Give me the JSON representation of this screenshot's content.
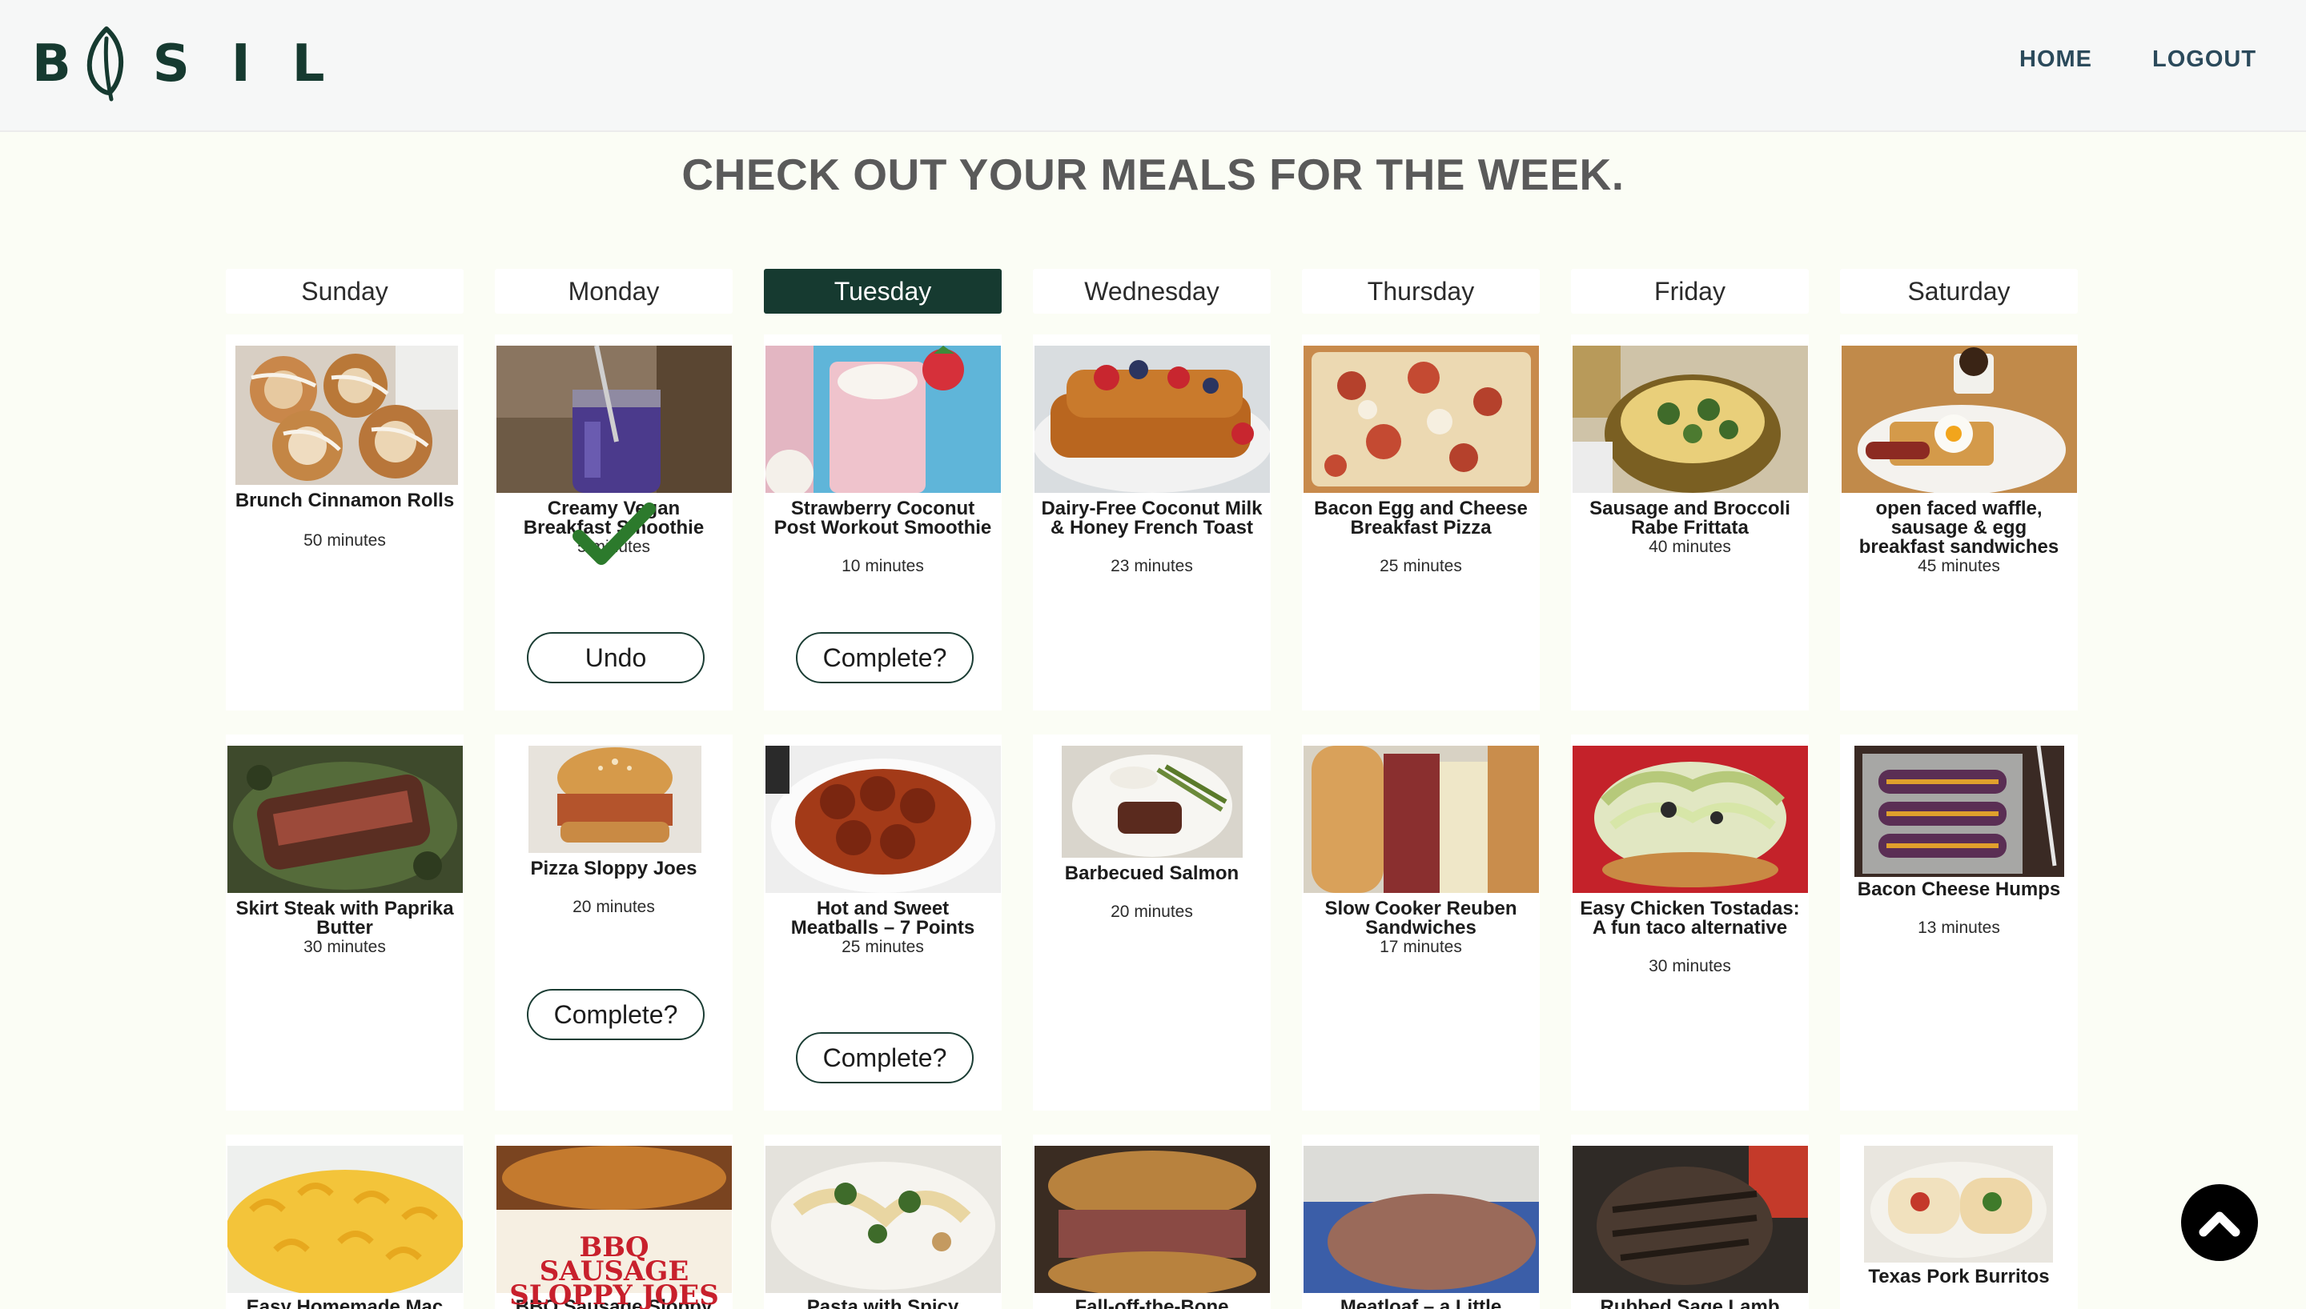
{
  "brand": {
    "letters": [
      "B",
      "S",
      "I",
      "L"
    ],
    "color": "#163a30",
    "logo_icon": "leaf-icon"
  },
  "nav": {
    "home": "HOME",
    "logout": "LOGOUT"
  },
  "page_title": "CHECK OUT YOUR MEALS FOR THE WEEK.",
  "days": [
    "Sunday",
    "Monday",
    "Tuesday",
    "Wednesday",
    "Thursday",
    "Friday",
    "Saturday"
  ],
  "active_day": "Tuesday",
  "accent_color": "#163a30",
  "weeks": [
    {
      "meals": [
        {
          "name": "Brunch Cinnamon Rolls",
          "time": "50 minutes"
        },
        {
          "name": "Creamy Vegan Breakfast Smoothie",
          "time": "5 minutes",
          "completed": true,
          "button": "Undo"
        },
        {
          "name": "Strawberry Coconut Post Workout Smoothie",
          "time": "10 minutes",
          "button": "Complete?"
        },
        {
          "name": "Dairy-Free Coconut Milk & Honey French Toast",
          "time": "23 minutes"
        },
        {
          "name": "Bacon Egg and Cheese Breakfast Pizza",
          "time": "25 minutes"
        },
        {
          "name": "Sausage and Broccoli Rabe Frittata",
          "time": "40 minutes"
        },
        {
          "name": "open faced waffle, sausage & egg breakfast sandwiches",
          "time": "45 minutes"
        }
      ]
    },
    {
      "meals": [
        {
          "name": "Skirt Steak with Paprika Butter",
          "time": "30 minutes"
        },
        {
          "name": "Pizza Sloppy Joes",
          "time": "20 minutes",
          "button": "Complete?"
        },
        {
          "name": "Hot and Sweet Meatballs – 7 Points",
          "time": "25 minutes",
          "button": "Complete?"
        },
        {
          "name": "Barbecued Salmon",
          "time": "20 minutes"
        },
        {
          "name": "Slow Cooker Reuben Sandwiches",
          "time": "17 minutes"
        },
        {
          "name": "Easy Chicken Tostadas: A fun taco alternative",
          "time": "30 minutes"
        },
        {
          "name": "Bacon Cheese Humps",
          "time": "13 minutes"
        }
      ]
    },
    {
      "meals": [
        {
          "name": "Easy Homemade Mac"
        },
        {
          "name": "BBQ Sausage Sloppy",
          "image_text": "BBQ SAUSAGE SLOPPY JOES"
        },
        {
          "name": "Pasta with Spicy"
        },
        {
          "name": "Fall-off-the-Bone"
        },
        {
          "name": "Meatloaf – a Little"
        },
        {
          "name": "Rubbed Sage Lamb"
        },
        {
          "name": "Texas Pork Burritos"
        }
      ]
    }
  ],
  "scroll_top_icon": "chevron-up-icon"
}
